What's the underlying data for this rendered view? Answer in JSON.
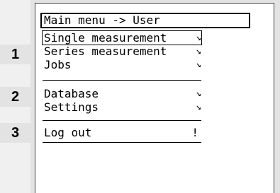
{
  "header": {
    "title": "Main menu -> User"
  },
  "callouts": [
    "1",
    "2",
    "3"
  ],
  "menu": {
    "selected_index": 0,
    "group1": [
      {
        "label": "Single measurement",
        "indicator": "↘"
      },
      {
        "label": "Series measurement",
        "indicator": "↘"
      },
      {
        "label": "Jobs",
        "indicator": "↘"
      }
    ],
    "group2": [
      {
        "label": "Database",
        "indicator": "↘"
      },
      {
        "label": "Settings",
        "indicator": "↘"
      }
    ],
    "group3": [
      {
        "label": "Log out",
        "indicator": "!"
      }
    ]
  }
}
